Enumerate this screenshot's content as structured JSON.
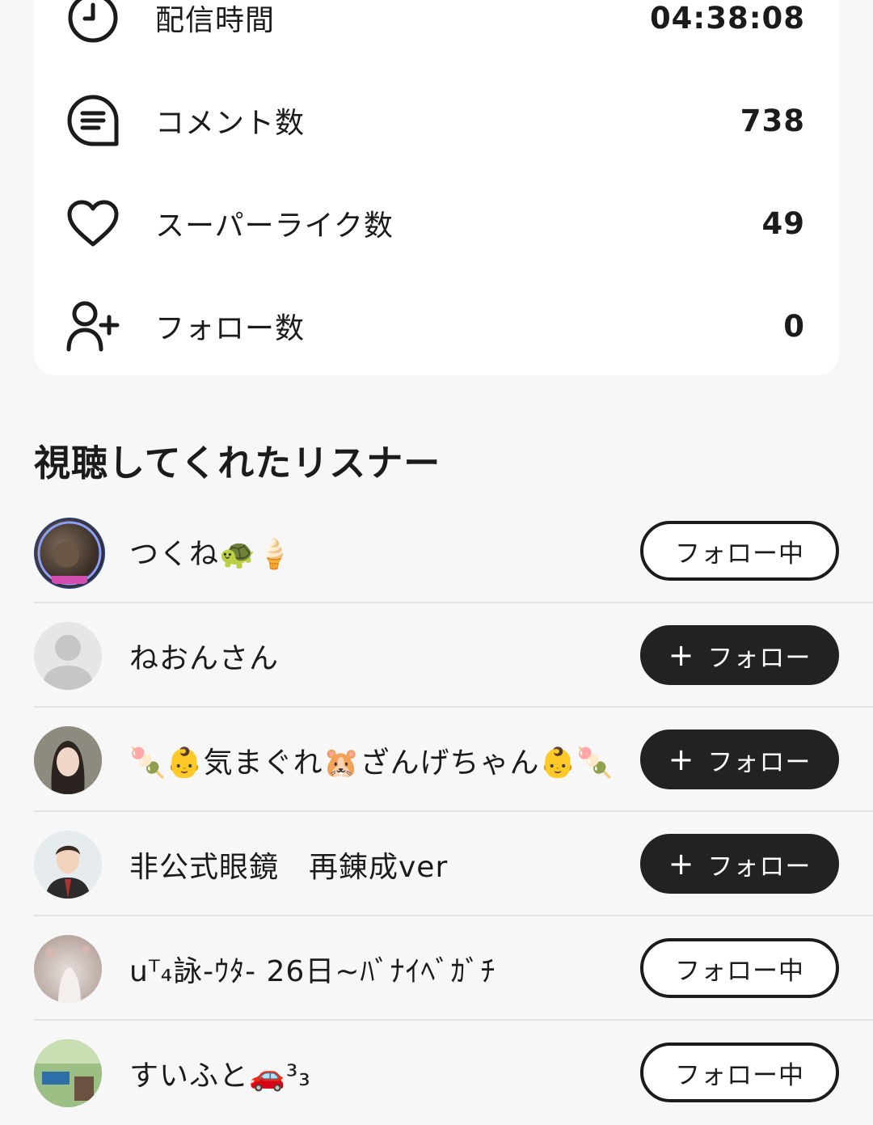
{
  "stats": [
    {
      "icon": "clock-icon",
      "label": "配信時間",
      "value": "04:38:08"
    },
    {
      "icon": "comment-icon",
      "label": "コメント数",
      "value": "738"
    },
    {
      "icon": "heart-icon",
      "label": "スーパーライク数",
      "value": "49"
    },
    {
      "icon": "add-user-icon",
      "label": "フォロー数",
      "value": "0"
    }
  ],
  "section_title": "視聴してくれたリスナー",
  "listeners": [
    {
      "name": "つくね🐢🍦",
      "button": "フォロー中",
      "status": "following"
    },
    {
      "name": "ねおんさん",
      "button": "フォロー",
      "status": "follow"
    },
    {
      "name": "🍡👶気まぐれ🐹ざんげちゃん👶🍡",
      "button": "フォロー",
      "status": "follow"
    },
    {
      "name": "非公式眼鏡　再錬成ver",
      "button": "フォロー",
      "status": "follow"
    },
    {
      "name": "uᵀ₄詠-ｳﾀ- 26日~ﾊﾞﾅｲﾍﾞｶﾞﾁ",
      "button": "フォロー中",
      "status": "following"
    },
    {
      "name": "すいふと🚗³₃",
      "button": "フォロー中",
      "status": "following"
    }
  ],
  "follow_plus": "+"
}
